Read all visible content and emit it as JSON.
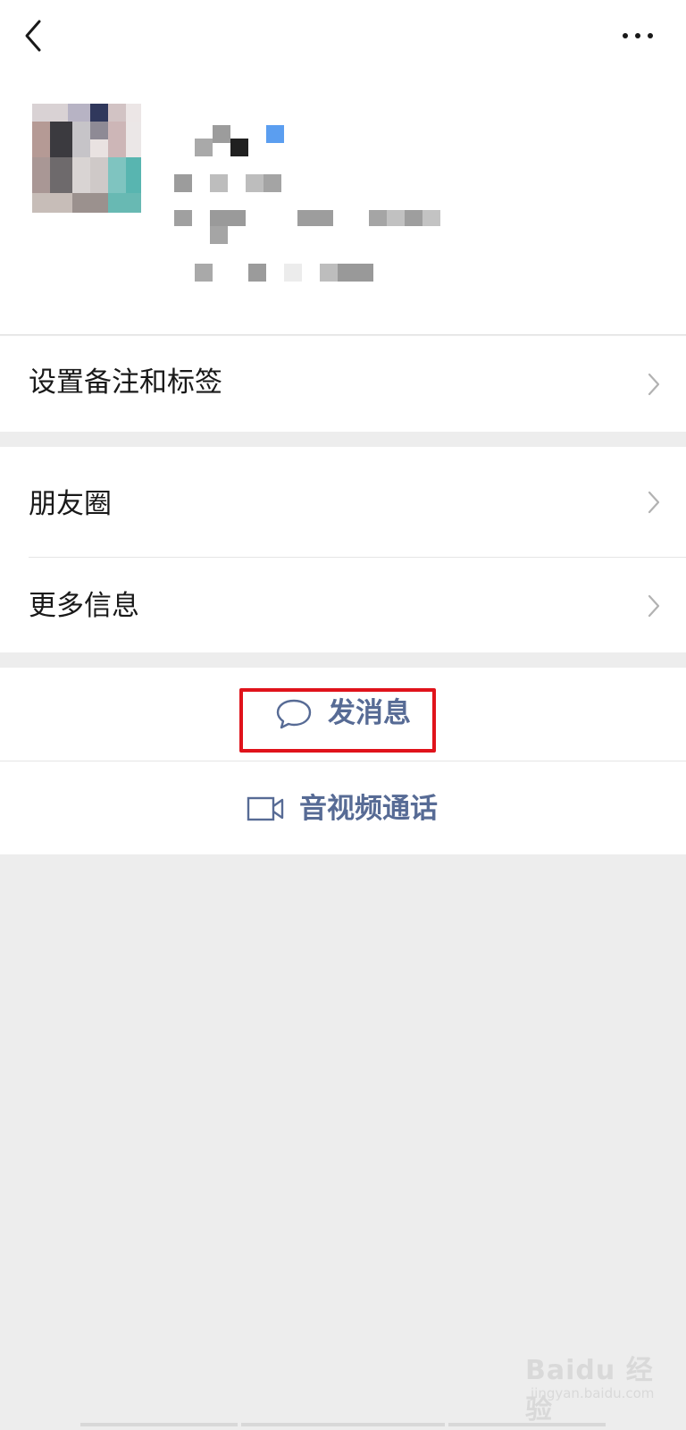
{
  "nav": {
    "back_icon": "chevron-left-icon",
    "more_icon": "more-horizontal-icon"
  },
  "menu": {
    "remark_tags": "设置备注和标签",
    "moments": "朋友圈",
    "more_info": "更多信息"
  },
  "actions": {
    "send_message": "发消息",
    "send_message_icon": "chat-bubble-icon",
    "av_call": "音视频通话",
    "av_call_icon": "video-camera-icon"
  },
  "watermark": {
    "brand": "Bai",
    "brand_suffix": "du",
    "cn": "经验",
    "url": "jingyan.baidu.com"
  },
  "colors": {
    "link_blue": "#576b95",
    "highlight_red": "#e0131b",
    "background": "#ededed"
  }
}
